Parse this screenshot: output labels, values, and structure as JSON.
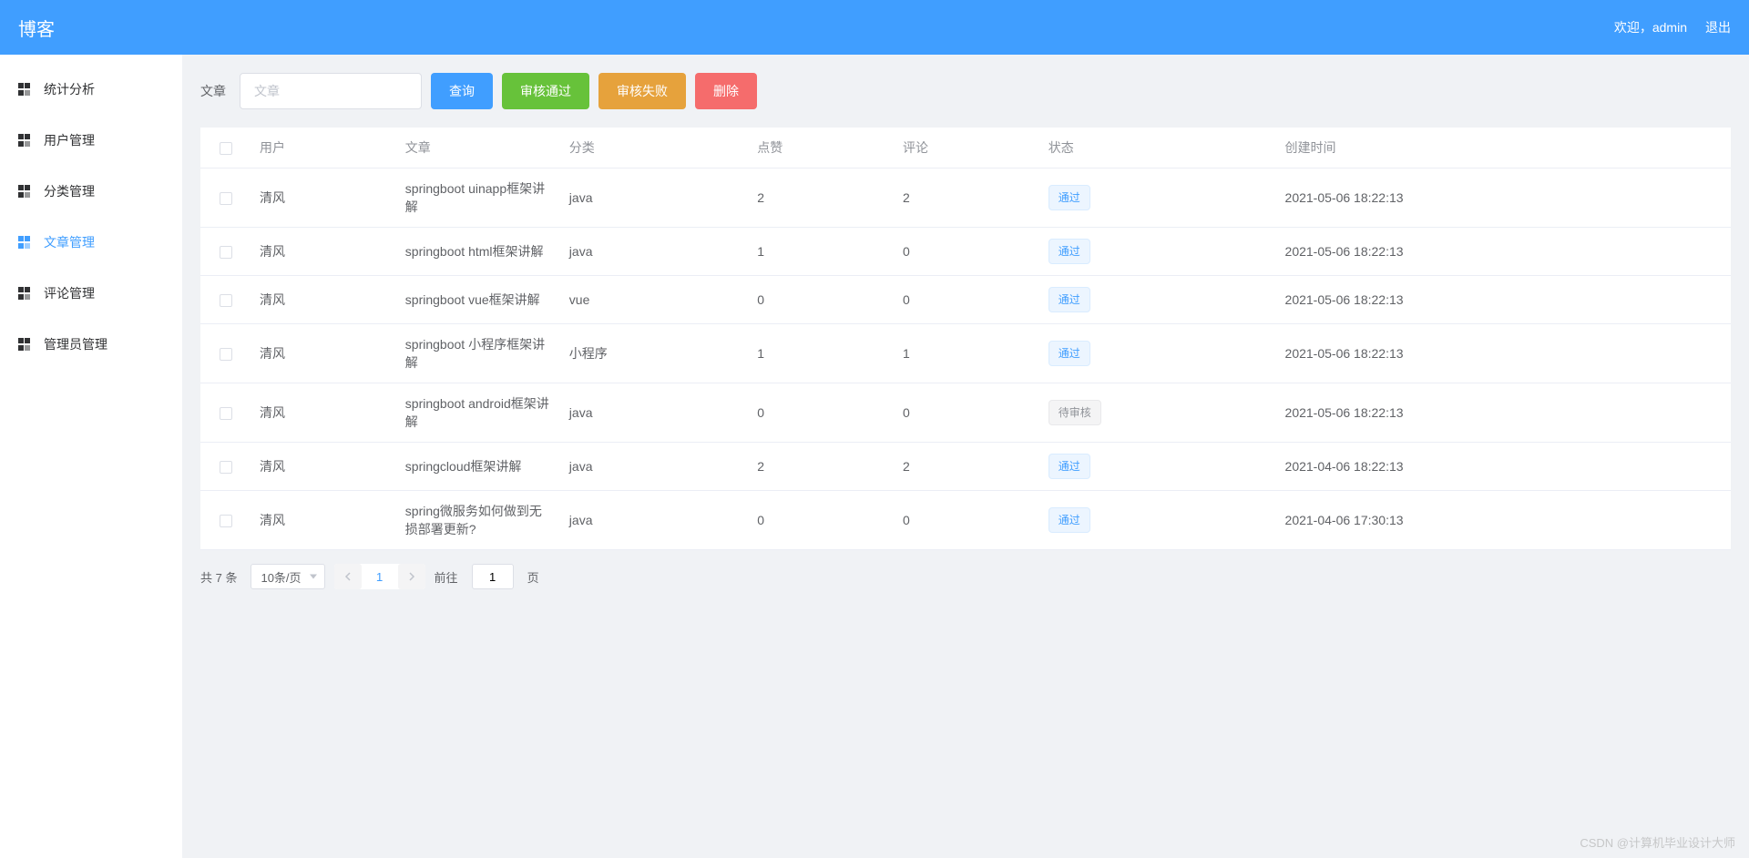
{
  "header": {
    "title": "博客",
    "welcome": "欢迎，admin",
    "logout": "退出"
  },
  "sidebar": {
    "items": [
      {
        "label": "统计分析",
        "active": false
      },
      {
        "label": "用户管理",
        "active": false
      },
      {
        "label": "分类管理",
        "active": false
      },
      {
        "label": "文章管理",
        "active": true
      },
      {
        "label": "评论管理",
        "active": false
      },
      {
        "label": "管理员管理",
        "active": false
      }
    ]
  },
  "toolbar": {
    "label": "文章",
    "search_placeholder": "文章",
    "query_btn": "查询",
    "approve_btn": "审核通过",
    "reject_btn": "审核失败",
    "delete_btn": "删除"
  },
  "table": {
    "headers": {
      "user": "用户",
      "article": "文章",
      "category": "分类",
      "likes": "点赞",
      "comments": "评论",
      "status": "状态",
      "created": "创建时间"
    },
    "status_labels": {
      "approved": "通过",
      "pending": "待审核"
    },
    "rows": [
      {
        "user": "清风",
        "article": "springboot uinapp框架讲解",
        "category": "java",
        "likes": "2",
        "comments": "2",
        "status": "approved",
        "created": "2021-05-06 18:22:13"
      },
      {
        "user": "清风",
        "article": "springboot html框架讲解",
        "category": "java",
        "likes": "1",
        "comments": "0",
        "status": "approved",
        "created": "2021-05-06 18:22:13"
      },
      {
        "user": "清风",
        "article": "springboot vue框架讲解",
        "category": "vue",
        "likes": "0",
        "comments": "0",
        "status": "approved",
        "created": "2021-05-06 18:22:13"
      },
      {
        "user": "清风",
        "article": "springboot 小程序框架讲解",
        "category": "小程序",
        "likes": "1",
        "comments": "1",
        "status": "approved",
        "created": "2021-05-06 18:22:13"
      },
      {
        "user": "清风",
        "article": "springboot android框架讲解",
        "category": "java",
        "likes": "0",
        "comments": "0",
        "status": "pending",
        "created": "2021-05-06 18:22:13"
      },
      {
        "user": "清风",
        "article": "springcloud框架讲解",
        "category": "java",
        "likes": "2",
        "comments": "2",
        "status": "approved",
        "created": "2021-04-06 18:22:13"
      },
      {
        "user": "清风",
        "article": "spring微服务如何做到无损部署更新?",
        "category": "java",
        "likes": "0",
        "comments": "0",
        "status": "approved",
        "created": "2021-04-06 17:30:13"
      }
    ]
  },
  "pagination": {
    "total_text": "共 7 条",
    "page_size_text": "10条/页",
    "current_page": "1",
    "goto_label": "前往",
    "page_suffix": "页",
    "goto_value": "1"
  },
  "watermark": "CSDN @计算机毕业设计大师"
}
